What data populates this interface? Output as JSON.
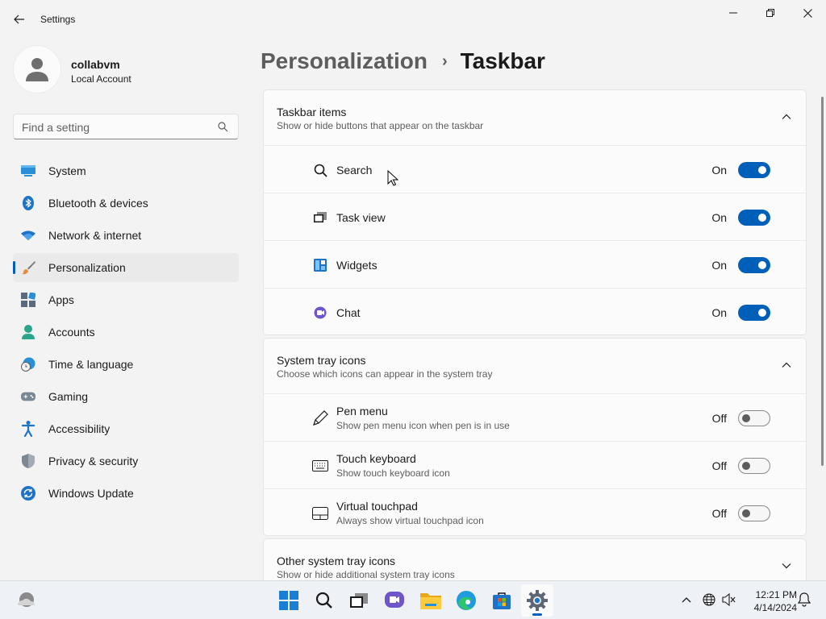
{
  "window": {
    "title": "Settings"
  },
  "user": {
    "name": "collabvm",
    "account_type": "Local Account"
  },
  "search": {
    "placeholder": "Find a setting"
  },
  "nav": [
    {
      "label": "System",
      "icon": "system-icon"
    },
    {
      "label": "Bluetooth & devices",
      "icon": "bluetooth-icon"
    },
    {
      "label": "Network & internet",
      "icon": "wifi-icon"
    },
    {
      "label": "Personalization",
      "icon": "brush-icon",
      "active": true
    },
    {
      "label": "Apps",
      "icon": "apps-icon"
    },
    {
      "label": "Accounts",
      "icon": "accounts-icon"
    },
    {
      "label": "Time & language",
      "icon": "clock-globe-icon"
    },
    {
      "label": "Gaming",
      "icon": "gamepad-icon"
    },
    {
      "label": "Accessibility",
      "icon": "accessibility-icon"
    },
    {
      "label": "Privacy & security",
      "icon": "shield-icon"
    },
    {
      "label": "Windows Update",
      "icon": "update-icon"
    }
  ],
  "breadcrumb": {
    "parent": "Personalization",
    "separator": "›",
    "current": "Taskbar"
  },
  "taskbar_items": {
    "title": "Taskbar items",
    "subtitle": "Show or hide buttons that appear on the taskbar",
    "rows": [
      {
        "label": "Search",
        "state": "On",
        "icon": "search-icon"
      },
      {
        "label": "Task view",
        "state": "On",
        "icon": "task-view-icon"
      },
      {
        "label": "Widgets",
        "state": "On",
        "icon": "widgets-icon"
      },
      {
        "label": "Chat",
        "state": "On",
        "icon": "chat-icon"
      }
    ]
  },
  "system_tray": {
    "title": "System tray icons",
    "subtitle": "Choose which icons can appear in the system tray",
    "rows": [
      {
        "label": "Pen menu",
        "sub": "Show pen menu icon when pen is in use",
        "state": "Off",
        "icon": "pen-icon"
      },
      {
        "label": "Touch keyboard",
        "sub": "Show touch keyboard icon",
        "state": "Off",
        "icon": "keyboard-icon"
      },
      {
        "label": "Virtual touchpad",
        "sub": "Always show virtual touchpad icon",
        "state": "Off",
        "icon": "touchpad-icon"
      }
    ]
  },
  "other_tray": {
    "title": "Other system tray icons",
    "subtitle": "Show or hide additional system tray icons"
  },
  "clock": {
    "time": "12:21 PM",
    "date": "4/14/2024"
  },
  "colors": {
    "accent": "#005fb8",
    "background": "#f3f3f3",
    "card": "#fbfbfb"
  }
}
